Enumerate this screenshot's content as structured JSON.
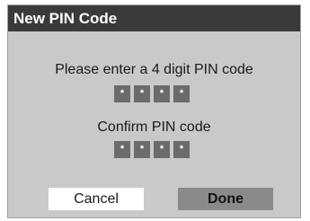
{
  "dialog": {
    "title": "New PIN Code",
    "enter_prompt": "Please enter a 4 digit PIN code",
    "confirm_prompt": "Confirm PIN code",
    "pin_entry": [
      "*",
      "*",
      "*",
      "*"
    ],
    "pin_confirm": [
      "*",
      "*",
      "*",
      "*"
    ],
    "cancel_label": "Cancel",
    "done_label": "Done"
  },
  "colors": {
    "titlebar": "#3a3a3a",
    "dialog_background": "#c9c9c9",
    "pin_box": "#6b6b6b",
    "done_button": "#8a8a8a"
  }
}
